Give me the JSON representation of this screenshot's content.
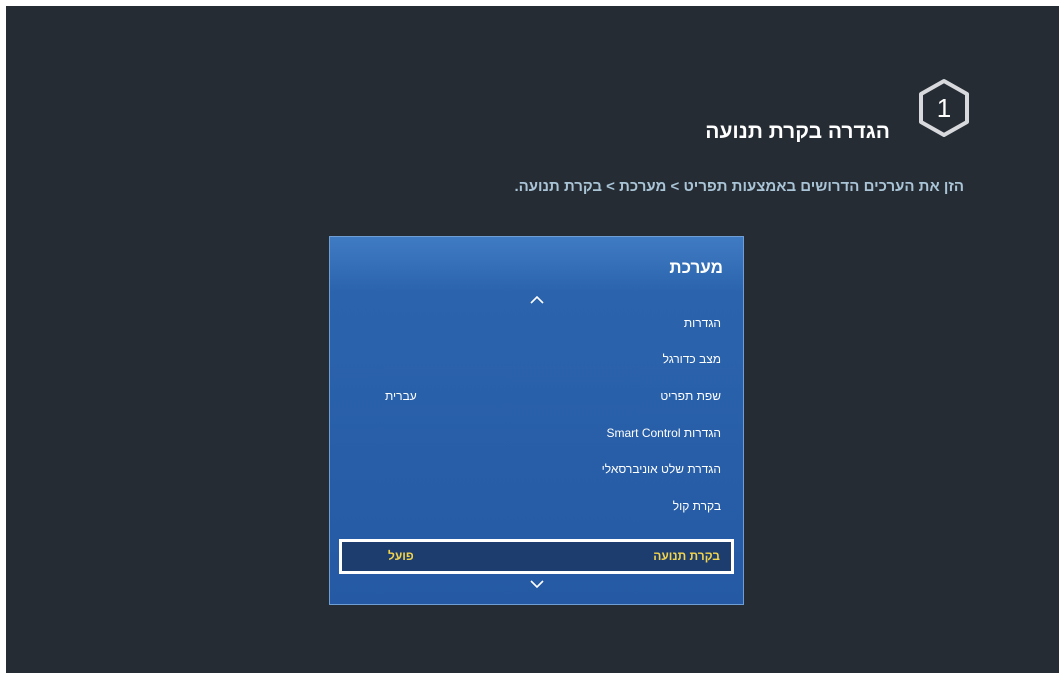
{
  "step": {
    "number": "1"
  },
  "title": "הגדרה בקרת תנועה",
  "instruction": "הזן את הערכים הדרושים באמצעות תפריט > מערכת > בקרת תנועה.",
  "menu": {
    "title": "מערכת",
    "items": [
      {
        "label": "הגדרות",
        "value": ""
      },
      {
        "label": "מצב כדורגל",
        "value": ""
      },
      {
        "label": "שפת תפריט",
        "value": "עברית"
      },
      {
        "label": "הגדרות Smart Control",
        "value": ""
      },
      {
        "label": "הגדרת שלט אוניברסאלי",
        "value": ""
      },
      {
        "label": "בקרת קול",
        "value": ""
      },
      {
        "label": "בקרת תנועה",
        "value": "פועל",
        "selected": true
      }
    ]
  },
  "colors": {
    "background": "#262c34",
    "panel": "#2b64ad",
    "highlight_text": "#f2d44a",
    "instruction_text": "#a9c4d6"
  },
  "icons": {
    "step_badge": "hexagon-badge-icon",
    "scroll_up": "chevron-up-icon",
    "scroll_down": "chevron-down-icon"
  }
}
